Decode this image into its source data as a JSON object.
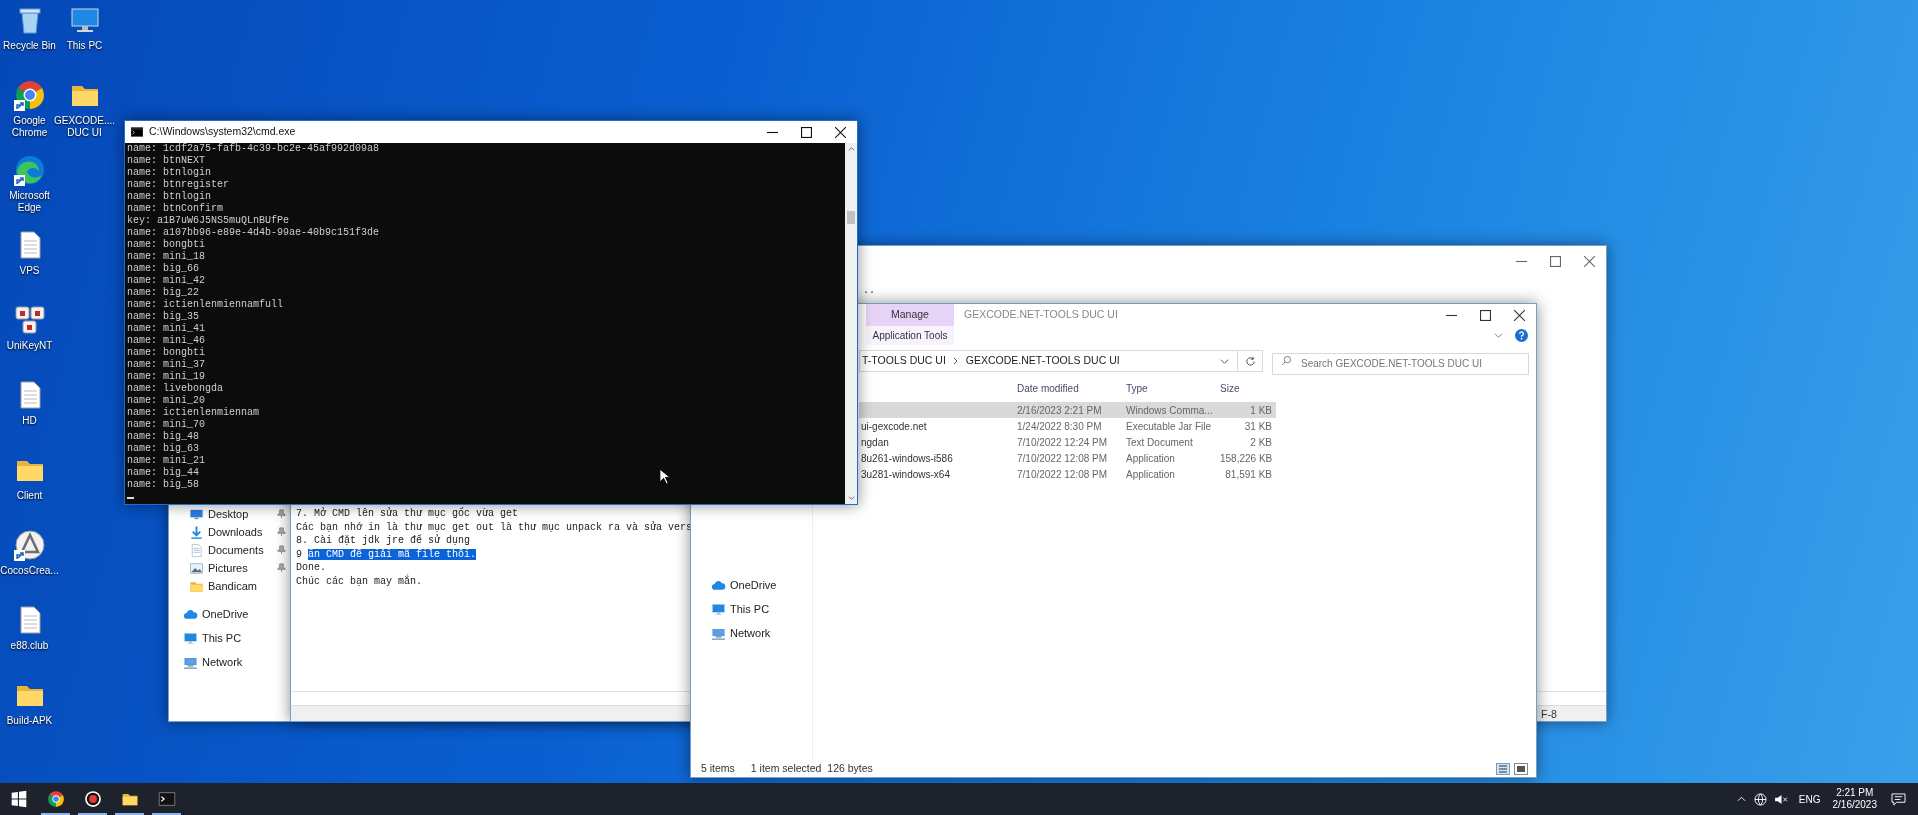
{
  "desktop": {
    "columns": [
      [
        {
          "label": "Recycle Bin",
          "kind": "recycle",
          "shortcut": false
        },
        {
          "label": "Google\nChrome",
          "kind": "chrome",
          "shortcut": true
        },
        {
          "label": "Microsoft\nEdge",
          "kind": "edge",
          "shortcut": true
        },
        {
          "label": "VPS",
          "kind": "document",
          "shortcut": false
        },
        {
          "label": "UniKeyNT",
          "kind": "unikey",
          "shortcut": false
        },
        {
          "label": "HD",
          "kind": "document",
          "shortcut": false
        },
        {
          "label": "Client",
          "kind": "folder",
          "shortcut": false
        },
        {
          "label": "CocosCrea...",
          "kind": "cocos",
          "shortcut": true
        },
        {
          "label": "e88.club",
          "kind": "document",
          "shortcut": false
        },
        {
          "label": "Build-APK",
          "kind": "folder",
          "shortcut": false
        }
      ],
      [
        {
          "label": "This PC",
          "kind": "pc",
          "shortcut": false
        },
        {
          "label": "GEXCODE....\nDUC UI",
          "kind": "folder",
          "shortcut": false
        }
      ]
    ]
  },
  "back_explorer": {
    "quick_access": [
      {
        "label": "Desktop",
        "kind": "desktop",
        "pinned": true
      },
      {
        "label": "Downloads",
        "kind": "download",
        "pinned": true
      },
      {
        "label": "Documents",
        "kind": "documents",
        "pinned": true
      },
      {
        "label": "Pictures",
        "kind": "pictures",
        "pinned": true
      },
      {
        "label": "Bandicam",
        "kind": "folder",
        "pinned": false
      }
    ],
    "locations": [
      {
        "label": "OneDrive",
        "kind": "cloud"
      },
      {
        "label": "This PC",
        "kind": "pc"
      },
      {
        "label": "Network",
        "kind": "network"
      }
    ]
  },
  "notepad": {
    "fragment": "..",
    "lines": [
      {
        "text": "7. Mở CMD lên sửa thư mục gốc vừa get"
      },
      {
        "text": "Các bạn nhớ in là thư mục get out là thư mục unpack ra và sửa vers"
      },
      {
        "text": "8. Cài đặt jdk jre để sử dụng"
      },
      {
        "text": "9 ",
        "selection": "ấn CMD để giải mã file thôi."
      },
      {
        "text": "Done."
      },
      {
        "text": "Chúc các bạn may mắn."
      }
    ],
    "status": "F-8"
  },
  "explorer": {
    "title": "GEXCODE.NET-TOOLS DUC UI",
    "ribbon_tab": {
      "label": "Manage",
      "subtitle": "Application Tools"
    },
    "breadcrumb": [
      "T-TOOLS DUC UI",
      "GEXCODE.NET-TOOLS DUC UI"
    ],
    "search": {
      "placeholder": "Search GEXCODE.NET-TOOLS DUC UI"
    },
    "nav_items": [
      {
        "label": "OneDrive",
        "kind": "cloud"
      },
      {
        "label": "This PC",
        "kind": "pc"
      },
      {
        "label": "Network",
        "kind": "network"
      }
    ],
    "columns": [
      "Date modified",
      "Type",
      "Size"
    ],
    "files": [
      {
        "modified": "2/16/2023 2:21 PM",
        "type": "Windows Comma...",
        "size": "1 KB",
        "selected": true
      },
      {
        "name": "ui-gexcode.net",
        "modified": "1/24/2022 8:30 PM",
        "type": "Executable Jar File",
        "size": "31 KB",
        "selected": false
      },
      {
        "name": "ngdan",
        "modified": "7/10/2022 12:24 PM",
        "type": "Text Document",
        "size": "2 KB",
        "selected": false
      },
      {
        "name": "8u261-windows-i586",
        "modified": "7/10/2022 12:08 PM",
        "type": "Application",
        "size": "158,226 KB",
        "selected": false
      },
      {
        "name": "3u281-windows-x64",
        "modified": "7/10/2022 12:08 PM",
        "type": "Application",
        "size": "81,591 KB",
        "selected": false
      }
    ],
    "status": {
      "count": "5 items",
      "selection": "1 item selected  126 bytes"
    }
  },
  "cmd": {
    "title": "C:\\Windows\\system32\\cmd.exe",
    "lines": [
      "name: 1cdf2a75-fafb-4c39-bc2e-45af992d09a8",
      "name: btnNEXT",
      "name: btnlogin",
      "name: btnregister",
      "name: btnlogin",
      "name: btnConfirm",
      "key: a1B7uW6J5NS5muQLnBUfPe",
      "name: a107bb96-e89e-4d4b-99ae-40b9c151f3de",
      "name: bongbti",
      "name: mini_18",
      "name: big_66",
      "name: mini_42",
      "name: big_22",
      "name: ictienlenmiennamfull",
      "name: big_35",
      "name: mini_41",
      "name: mini_46",
      "name: bongbti",
      "name: mini_37",
      "name: mini_19",
      "name: livebongda",
      "name: mini_20",
      "name: ictienlenmiennam",
      "name: mini_70",
      "name: big_48",
      "name: big_63",
      "name: mini_21",
      "name: big_44",
      "name: big_58"
    ]
  },
  "taskbar": {
    "apps": [
      {
        "kind": "start",
        "running": false
      },
      {
        "kind": "chrome",
        "running": true
      },
      {
        "kind": "record",
        "running": true
      },
      {
        "kind": "folder",
        "running": true
      },
      {
        "kind": "terminal",
        "running": true
      }
    ],
    "language": "ENG",
    "time": "2:21 PM",
    "date": "2/16/2023"
  }
}
